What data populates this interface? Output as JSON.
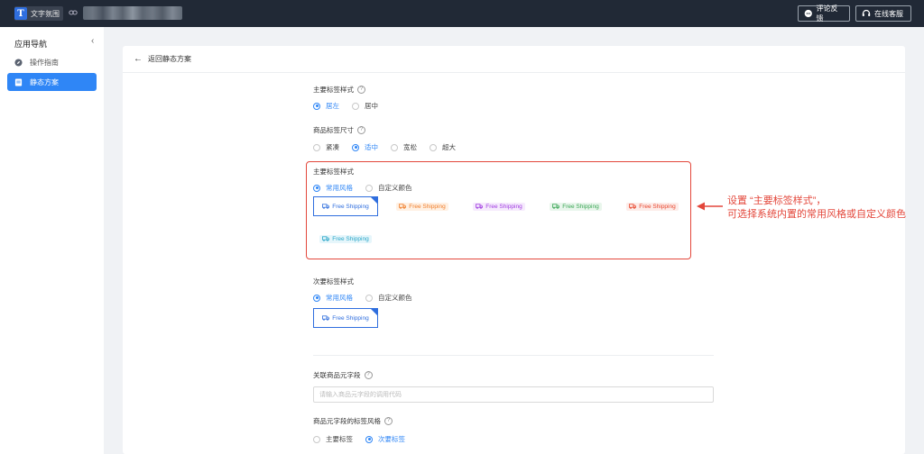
{
  "header": {
    "logo_letter": "T",
    "app_name": "文字氛围",
    "feedback_label": "评论反馈",
    "service_label": "在线客服"
  },
  "sidebar": {
    "title": "应用导航",
    "items": [
      {
        "label": "操作指南",
        "icon": "compass-icon",
        "active": false
      },
      {
        "label": "静态方案",
        "icon": "document-icon",
        "active": true
      }
    ]
  },
  "page": {
    "back_label": "返回静态方案"
  },
  "form": {
    "main_label_style": {
      "label": "主要标签样式",
      "options": [
        "居左",
        "居中"
      ],
      "selected": "居左"
    },
    "label_size": {
      "label": "商品标签尺寸",
      "options": [
        "紧凑",
        "适中",
        "宽松",
        "超大"
      ],
      "selected": "适中"
    },
    "main_tag_style": {
      "label": "主要标签样式",
      "options": [
        "常用风格",
        "自定义颜色"
      ],
      "selected": "常用风格",
      "tags": [
        {
          "text": "Free Shipping",
          "color": "#2f6ede",
          "bg": "#ffffff"
        },
        {
          "text": "Free Shipping",
          "color": "#f07d2a",
          "bg": "#fff1e4"
        },
        {
          "text": "Free Shipping",
          "color": "#a03be0",
          "bg": "#f6ebfd"
        },
        {
          "text": "Free Shipping",
          "color": "#3aa655",
          "bg": "#e9f6ec"
        },
        {
          "text": "Free Shipping",
          "color": "#e8452c",
          "bg": "#fdece9"
        },
        {
          "text": "Free Shipping",
          "color": "#2aa6c8",
          "bg": "#e6f6fb"
        }
      ]
    },
    "secondary_tag_style": {
      "label": "次要标签样式",
      "options": [
        "常用风格",
        "自定义颜色"
      ],
      "selected": "常用风格",
      "tag": {
        "text": "Free Shipping",
        "color": "#2f6ede",
        "bg": "#ffffff"
      }
    },
    "meta_field": {
      "label": "关联商品元字段",
      "placeholder": "请输入商品元字段的调用代码"
    },
    "meta_tag_style": {
      "label": "商品元字段的标签风格",
      "options": [
        "主要标签",
        "次要标签"
      ],
      "selected": "次要标签"
    }
  },
  "annotation": {
    "line1": "设置 “主要标签样式”，",
    "line2": "可选择系统内置的常用风格或自定义颜色"
  },
  "colors": {
    "accent": "#2f86f6",
    "topbar": "#212936",
    "highlight": "#e3473b"
  }
}
